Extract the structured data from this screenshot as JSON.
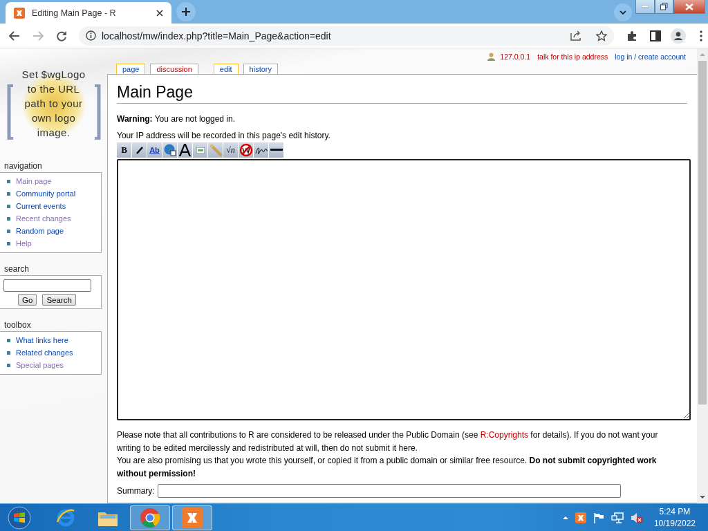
{
  "browser": {
    "tab_title": "Editing Main Page - R",
    "url": "localhost/mw/index.php?title=Main_Page&action=edit"
  },
  "personal_links": [
    {
      "text": "127.0.0.1",
      "new": true
    },
    {
      "text": "talk for this ip address",
      "new": true
    },
    {
      "text": "log in / create account",
      "new": false
    }
  ],
  "logo": {
    "text": "Set $wgLogo to the URL path to your own logo image."
  },
  "tabs": [
    {
      "label": "page",
      "selected": true,
      "new": false
    },
    {
      "label": "discussion",
      "selected": false,
      "new": true
    },
    {
      "label": "edit",
      "selected": true,
      "new": false
    },
    {
      "label": "history",
      "selected": false,
      "new": false
    }
  ],
  "sidebar": {
    "navigation": {
      "title": "navigation",
      "items": [
        {
          "label": "Main page",
          "visited": true
        },
        {
          "label": "Community portal",
          "visited": false
        },
        {
          "label": "Current events",
          "visited": false
        },
        {
          "label": "Recent changes",
          "visited": true
        },
        {
          "label": "Random page",
          "visited": false
        },
        {
          "label": "Help",
          "visited": true
        }
      ]
    },
    "search": {
      "title": "search",
      "buttons": [
        "Go",
        "Search"
      ]
    },
    "toolbox": {
      "title": "toolbox",
      "items": [
        {
          "label": "What links here",
          "visited": false
        },
        {
          "label": "Related changes",
          "visited": false
        },
        {
          "label": "Special pages",
          "visited": true
        }
      ]
    }
  },
  "content": {
    "title": "Main Page",
    "warning": "**Warning:** You are not logged in.",
    "ip_note": "Your IP address will be recorded in this page's edit history.",
    "toolbar": [
      {
        "kind": "bold",
        "glyph": "B"
      },
      {
        "kind": "italic"
      },
      {
        "kind": "internal-link",
        "glyph": "Ab"
      },
      {
        "kind": "external-link"
      },
      {
        "kind": "headline",
        "glyph": "A"
      },
      {
        "kind": "image"
      },
      {
        "kind": "media"
      },
      {
        "kind": "math",
        "glyph": "√n"
      },
      {
        "kind": "nowiki"
      },
      {
        "kind": "signature"
      },
      {
        "kind": "rule"
      }
    ],
    "notice_before": "Please note that all contributions to R are considered to be released under the Public Domain (see",
    "notice_link": "R:Copyrights",
    "notice_after": "for details). If you do not want your writing to be edited mercilessly and redistributed at will, then do not submit it here.",
    "promise": "You are also promising us that you wrote this yourself, or copied it from a public domain or similar free resource. **Do not submit copyrighted work without permission!**",
    "summary_label": "Summary:"
  },
  "taskbar": {
    "apps": [
      {
        "kind": "ie",
        "active": false
      },
      {
        "kind": "folder",
        "active": false
      },
      {
        "kind": "chrome",
        "active": true
      },
      {
        "kind": "xampp",
        "active": true
      }
    ],
    "time": "5:24 PM",
    "date": "10/19/2022"
  }
}
